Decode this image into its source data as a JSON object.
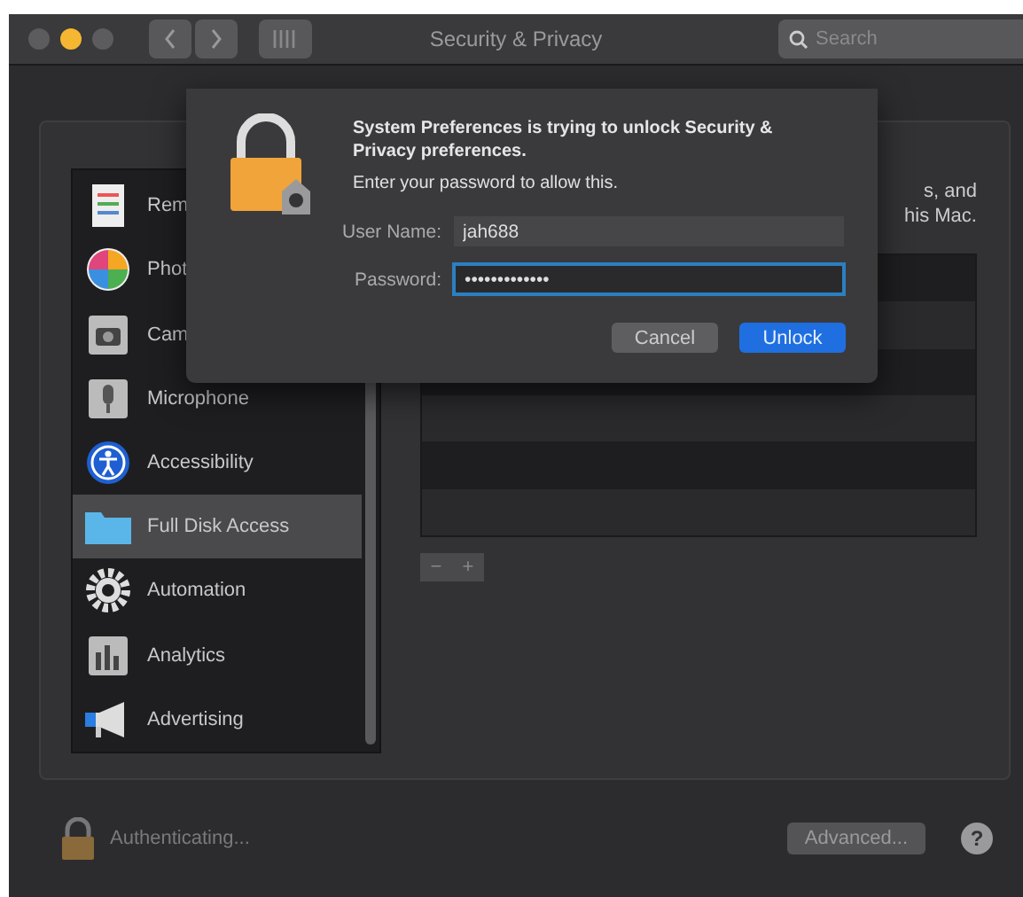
{
  "window": {
    "title": "Security & Privacy"
  },
  "search": {
    "placeholder": "Search"
  },
  "sidebar": {
    "items": [
      {
        "label": "Rem",
        "selected": false
      },
      {
        "label": "Phot",
        "selected": false
      },
      {
        "label": "Cam",
        "selected": false
      },
      {
        "label": "Microphone",
        "selected": false
      },
      {
        "label": "Accessibility",
        "selected": false
      },
      {
        "label": "Full Disk Access",
        "selected": true
      },
      {
        "label": "Automation",
        "selected": false
      },
      {
        "label": "Analytics",
        "selected": false
      },
      {
        "label": "Advertising",
        "selected": false
      }
    ]
  },
  "description": [
    "s, and",
    "his Mac."
  ],
  "list_buttons": [
    "−",
    "+"
  ],
  "status": {
    "text": "Authenticating...",
    "advanced_button": "Advanced...",
    "help": "?"
  },
  "dialog": {
    "message": "System Preferences is trying to unlock Security & Privacy preferences.",
    "prompt": "Enter your password to allow this.",
    "fields": [
      {
        "label": "User Name:",
        "value": "jah688",
        "focused": false
      },
      {
        "label": "Password:",
        "value": "•••••••••••••",
        "focused": true
      }
    ],
    "buttons": [
      {
        "label": "Cancel",
        "kind": "secondary"
      },
      {
        "label": "Unlock",
        "kind": "primary"
      }
    ]
  }
}
